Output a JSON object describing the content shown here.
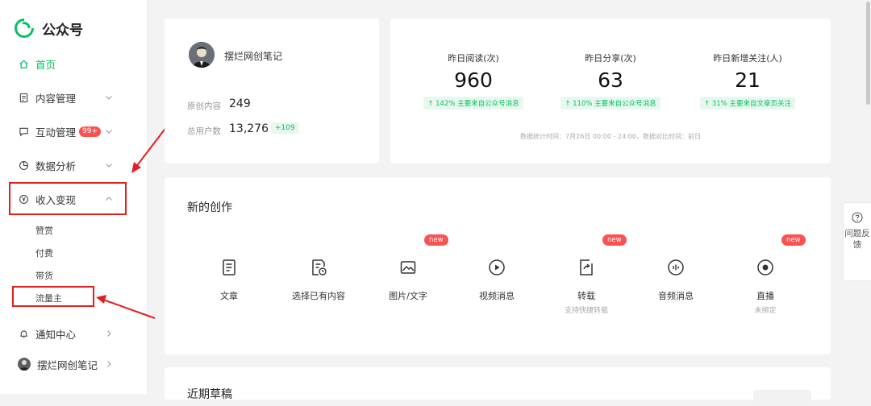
{
  "app": {
    "title": "公众号"
  },
  "sidebar": {
    "items": [
      {
        "label": "首页"
      },
      {
        "label": "内容管理"
      },
      {
        "label": "互动管理",
        "badge": "99+"
      },
      {
        "label": "数据分析"
      },
      {
        "label": "收入变现"
      }
    ],
    "sub_items": [
      "赞赏",
      "付费",
      "带货",
      "流量主"
    ],
    "bottom_items": [
      {
        "label": "通知中心"
      },
      {
        "label": "摆烂网创笔记"
      }
    ]
  },
  "profile": {
    "name": "摆烂网创笔记",
    "original_label": "原创内容",
    "original_value": "249",
    "users_label": "总用户数",
    "users_value": "13,276",
    "users_delta": "+109"
  },
  "metrics": [
    {
      "label": "昨日阅读(次)",
      "value": "960",
      "note": "↑ 142%   主要来自公众号消息"
    },
    {
      "label": "昨日分享(次)",
      "value": "63",
      "note": "↑ 110%   主要来自公众号消息"
    },
    {
      "label": "昨日新增关注(人)",
      "value": "21",
      "note": "↑ 31%   主要来自文章页关注"
    }
  ],
  "metrics_footnote": "数据统计时间：7月26日 00:00 - 24:00，数据对比时间：前日",
  "create": {
    "title": "新的创作",
    "new_badge": "new",
    "tools": [
      {
        "label": "文章",
        "sub": ""
      },
      {
        "label": "选择已有内容",
        "sub": ""
      },
      {
        "label": "图片/文字",
        "sub": ""
      },
      {
        "label": "视频消息",
        "sub": ""
      },
      {
        "label": "转载",
        "sub": "支持快捷转载"
      },
      {
        "label": "音频消息",
        "sub": ""
      },
      {
        "label": "直播",
        "sub": "未绑定"
      }
    ]
  },
  "recent": {
    "title": "近期草稿"
  },
  "feedback": {
    "label": "问题反馈"
  },
  "colors": {
    "brand": "#07c160",
    "badge": "#fa5151",
    "annotation": "#e02020"
  }
}
